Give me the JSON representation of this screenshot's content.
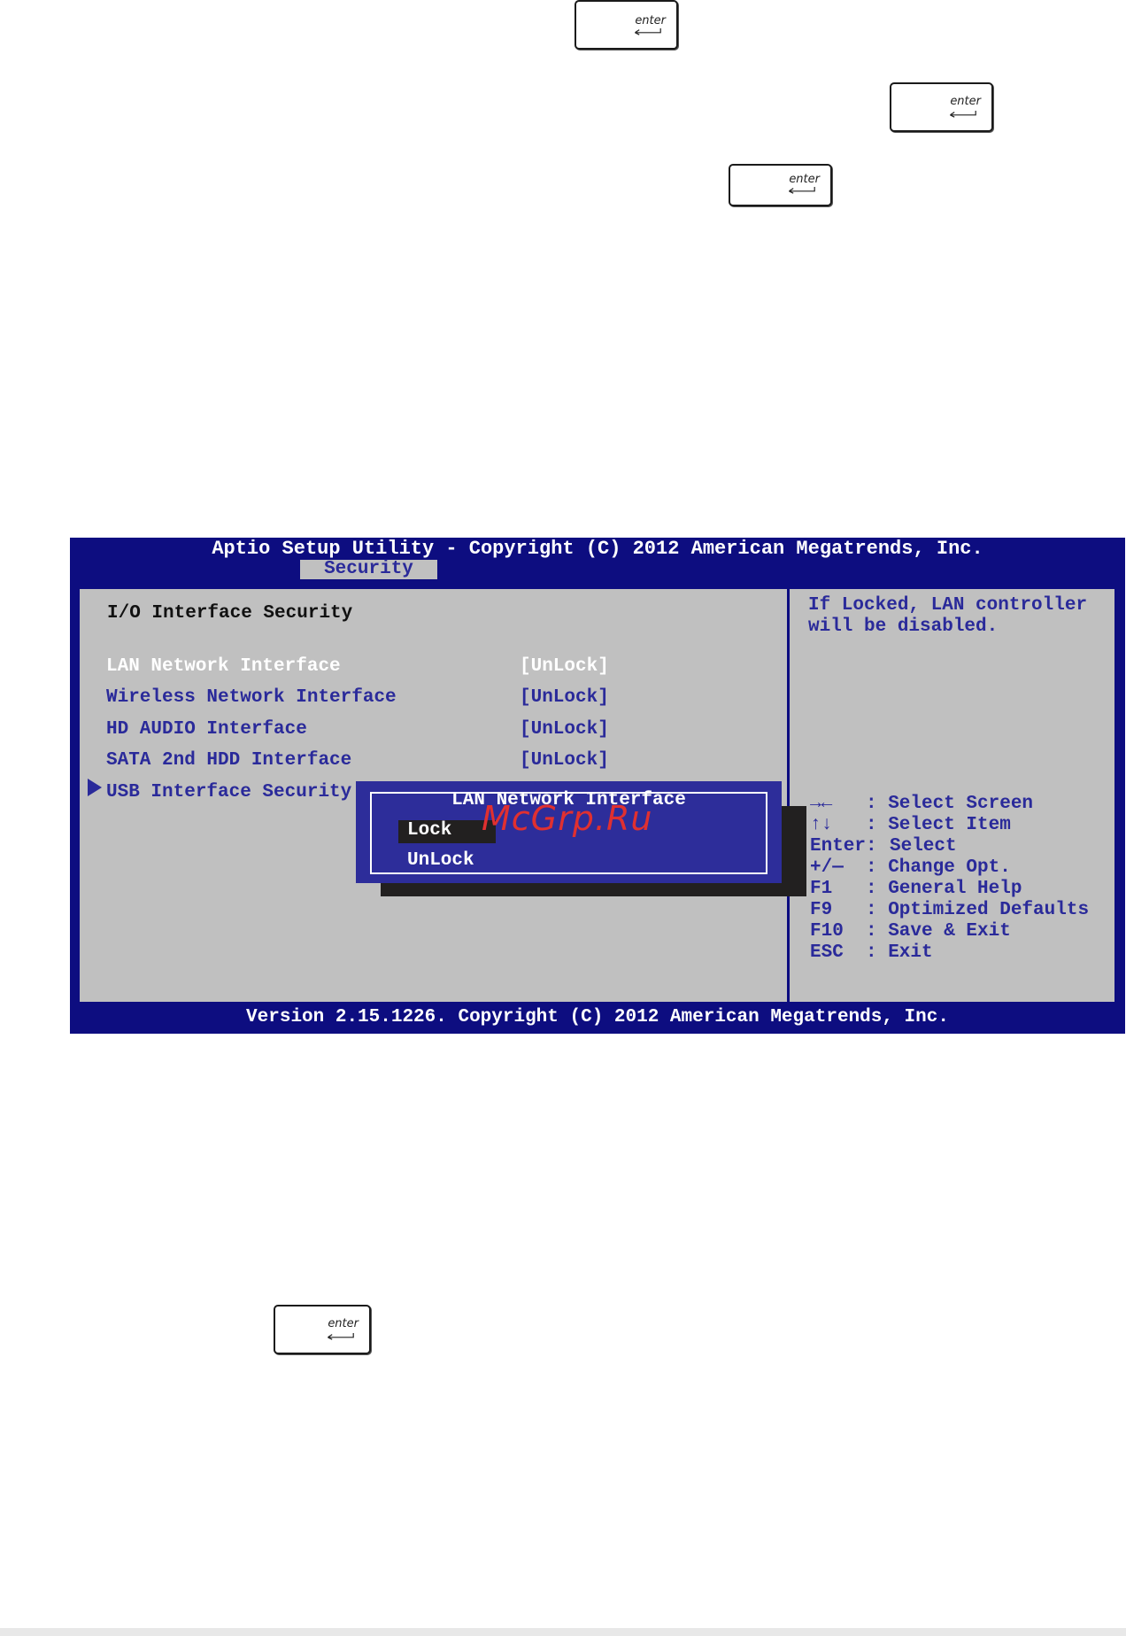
{
  "keys": {
    "enter_label": "enter"
  },
  "bios": {
    "header_title": "Aptio Setup Utility - Copyright (C) 2012 American Megatrends, Inc.",
    "active_tab": "Security",
    "section_title": "I/O Interface Security",
    "items": [
      {
        "label": "LAN Network Interface",
        "value": "[UnLock]"
      },
      {
        "label": "Wireless Network Interface",
        "value": "[UnLock]"
      },
      {
        "label": "HD AUDIO Interface",
        "value": "[UnLock]"
      },
      {
        "label": "SATA 2nd HDD Interface",
        "value": "[UnLock]"
      },
      {
        "label": "USB Interface Security",
        "value": ""
      }
    ],
    "popup": {
      "title": "LAN Network Interface",
      "options": [
        "Lock",
        "UnLock"
      ],
      "selected": "Lock"
    },
    "help": {
      "line1": "If Locked, LAN controller",
      "line2": "will be disabled."
    },
    "key_help": [
      {
        "key": "→←",
        "desc": ": Select Screen"
      },
      {
        "key": "↑↓",
        "desc": ": Select Item"
      },
      {
        "key": "Enter:",
        "desc": "Select"
      },
      {
        "key": "+/—",
        "desc": ": Change Opt."
      },
      {
        "key": "F1",
        "desc": ": General Help"
      },
      {
        "key": "F9",
        "desc": ": Optimized Defaults"
      },
      {
        "key": "F10",
        "desc": ": Save & Exit"
      },
      {
        "key": "ESC",
        "desc": ": Exit"
      }
    ],
    "footer": "Version 2.15.1226. Copyright (C) 2012 American Megatrends, Inc."
  },
  "watermark": "McGrp.Ru",
  "colors": {
    "bios_blue": "#0d0d80",
    "panel_gray": "#c0c0c0",
    "item_blue": "#2a2a9a",
    "popup_blue": "#2d2d9a"
  }
}
